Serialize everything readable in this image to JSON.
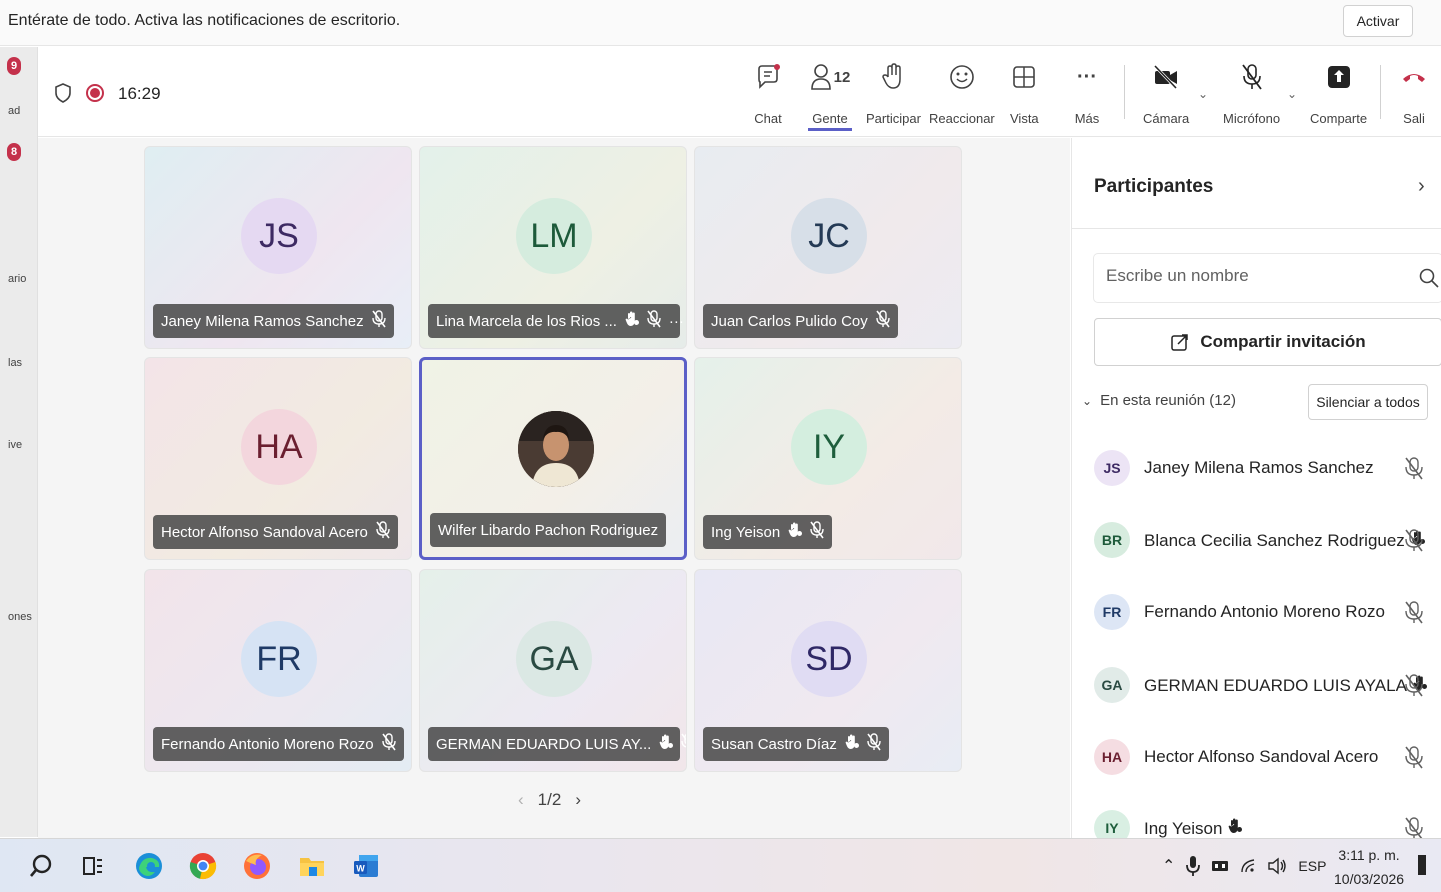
{
  "notification": {
    "text": "Entérate de todo. Activa las notificaciones de escritorio.",
    "activate_label": "Activar"
  },
  "rail": {
    "badges": [
      "9",
      "8"
    ],
    "labels": [
      "ad",
      "ario",
      "las",
      "ive",
      "ones"
    ]
  },
  "meeting": {
    "elapsed": "16:29",
    "toolbar": {
      "chat": "Chat",
      "people": "Gente",
      "people_count": "12",
      "raise_hand": "Participar",
      "react": "Reaccionar",
      "view": "Vista",
      "more": "Más",
      "camera": "Cámara",
      "mic": "Micrófono",
      "share": "Comparte",
      "leave": "Sali"
    }
  },
  "tiles": [
    {
      "initials": "JS",
      "name": "Janey Milena Ramos Sanchez",
      "hand": false,
      "more": false
    },
    {
      "initials": "LM",
      "name": "Lina Marcela de los Rios ...",
      "hand": true,
      "more": true
    },
    {
      "initials": "JC",
      "name": "Juan Carlos Pulido Coy",
      "hand": false,
      "more": false
    },
    {
      "initials": "HA",
      "name": "Hector Alfonso Sandoval Acero",
      "hand": false,
      "more": false
    },
    {
      "initials": "",
      "name": "Wilfer Libardo Pachon Rodriguez",
      "hand": false,
      "more": false,
      "photo": true
    },
    {
      "initials": "IY",
      "name": "Ing Yeison",
      "hand": true,
      "more": false
    },
    {
      "initials": "FR",
      "name": "Fernando Antonio Moreno Rozo",
      "hand": false,
      "more": false
    },
    {
      "initials": "GA",
      "name": "GERMAN EDUARDO LUIS AY...",
      "hand": true,
      "more": false
    },
    {
      "initials": "SD",
      "name": "Susan Castro Díaz",
      "hand": true,
      "more": false
    }
  ],
  "pager": {
    "text": "1/2"
  },
  "panel": {
    "title": "Participantes",
    "search_placeholder": "Escribe un nombre",
    "share_invite": "Compartir invitación",
    "section_label": "En esta reunión (12)",
    "mute_all": "Silenciar a todos",
    "participants": [
      {
        "initials": "JS",
        "name": "Janey Milena Ramos Sanchez",
        "hand": false
      },
      {
        "initials": "BR",
        "name": "Blanca Cecilia Sanchez Rodriguez",
        "hand": true
      },
      {
        "initials": "FR",
        "name": "Fernando Antonio Moreno Rozo",
        "hand": false
      },
      {
        "initials": "GA",
        "name": "GERMAN EDUARDO LUIS AYALA",
        "hand": true
      },
      {
        "initials": "HA",
        "name": "Hector Alfonso Sandoval Acero",
        "hand": false
      },
      {
        "initials": "IY",
        "name": "Ing Yeison",
        "hand": true
      }
    ]
  },
  "taskbar": {
    "language": "ESP",
    "time": "3:11 p. m.",
    "date": "10/03/2026"
  },
  "colors": {
    "accent": "#5b5fc7",
    "record": "#c4314b",
    "leave": "#c4314b"
  }
}
